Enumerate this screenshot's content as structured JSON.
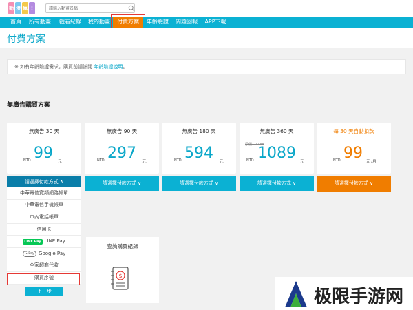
{
  "header": {
    "logo_text": "動漫",
    "search": {
      "placeholder": "請輸入動畫名稱"
    }
  },
  "nav": {
    "items": [
      {
        "label": "首頁"
      },
      {
        "label": "所有動畫"
      },
      {
        "label": "觀看紀錄"
      },
      {
        "label": "我的動畫"
      },
      {
        "label": "付費方案",
        "active": true
      },
      {
        "label": "年齡驗證"
      },
      {
        "label": "問題回報"
      },
      {
        "label": "APP下載"
      }
    ]
  },
  "page": {
    "title": "付費方案",
    "notice_prefix": "※ 如有年齡驗證需求，購買前請詳閱 ",
    "notice_link": "年齡驗證說明",
    "notice_suffix": "。",
    "section_title": "無廣告購買方案"
  },
  "plans": [
    {
      "name": "無廣告 30 天",
      "currency": "NTD",
      "price": "99",
      "unit": "元",
      "pay_label": "請選擇付款方式 ∧"
    },
    {
      "name": "無廣告 90 天",
      "currency": "NTD",
      "price": "297",
      "unit": "元",
      "pay_label": "請選擇付款方式 ∨"
    },
    {
      "name": "無廣告 180 天",
      "currency": "NTD",
      "price": "594",
      "unit": "元",
      "pay_label": "請選擇付款方式 ∨"
    },
    {
      "name": "無廣告 360 天",
      "original": "原價：1188",
      "currency": "NTD",
      "price": "1089",
      "unit": "元",
      "pay_label": "請選擇付款方式 ∨"
    },
    {
      "name": "每 30 天自動扣款",
      "currency": "NTD",
      "price": "99",
      "unit": "元 /月",
      "pay_label": "請選擇付款方式 ∨"
    }
  ],
  "payment_options": [
    {
      "label": "中華電信寬頻網路帳單"
    },
    {
      "label": "中華電信手機帳單"
    },
    {
      "label": "市內電話帳單"
    },
    {
      "label": "信用卡"
    },
    {
      "label": "LINE Pay",
      "badge": "LINE Pay"
    },
    {
      "label": "Google Pay",
      "badge": "G Pay"
    },
    {
      "label": "全家超商代收"
    },
    {
      "label": "購買序號"
    }
  ],
  "next_label": "下一步",
  "query": {
    "title": "查詢購買紀錄"
  },
  "watermark": {
    "text": "极限手游网"
  },
  "colors": {
    "accent": "#0bb1d3",
    "orange": "#f07d00",
    "highlight": "#e53935"
  }
}
